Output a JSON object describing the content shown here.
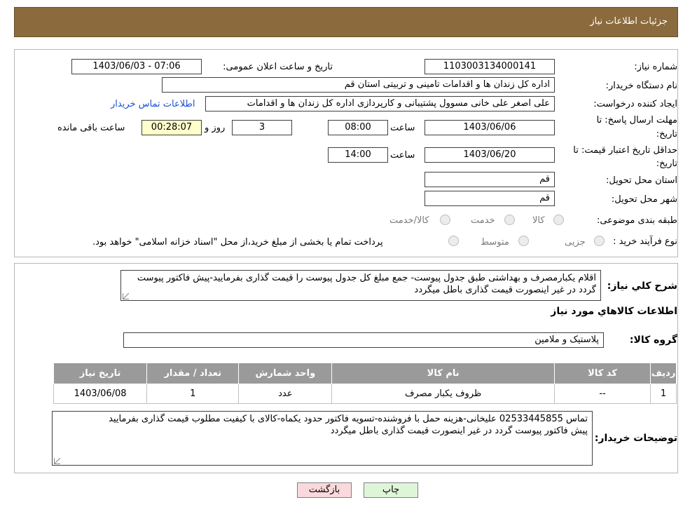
{
  "header": {
    "title": "جزئیات اطلاعات نیاز"
  },
  "form": {
    "need_number_label": "شماره نیاز:",
    "need_number": "1103003134000141",
    "announce_label": "تاریخ و ساعت اعلان عمومی:",
    "announce_value": "1403/06/03 - 07:06",
    "buyer_label": "نام دستگاه خریدار:",
    "buyer_value": "اداره کل زندان ها و اقدامات تامینی و تربیتی استان قم",
    "creator_label": "ایجاد کننده درخواست:",
    "creator_value": "علی اصغر علی خانی مسوول پشتیبانی و کارپردازی اداره کل زندان ها و اقدامات",
    "contact_link": "اطلاعات تماس خریدار",
    "deadline_label_1": "مهلت ارسال پاسخ: تا",
    "deadline_label_2": "تاریخ:",
    "deadline_date": "1403/06/06",
    "time_label": "ساعت",
    "deadline_time": "08:00",
    "days_value": "3",
    "days_label": "روز و",
    "remaining_value": "00:28:07",
    "remaining_label": "ساعت باقی مانده",
    "validity_label_1": "حداقل تاریخ اعتبار قیمت: تا",
    "validity_label_2": "تاریخ:",
    "validity_date": "1403/06/20",
    "validity_time": "14:00",
    "province_label": "استان محل تحویل:",
    "province_value": "قم",
    "city_label": "شهر محل تحویل:",
    "city_value": "قم",
    "category_label": "طبقه بندی موضوعی:",
    "category_options": [
      "کالا",
      "خدمت",
      "کالا/خدمت"
    ],
    "process_label": "نوع فرآیند خرید :",
    "process_options": [
      "جزیی",
      "متوسط"
    ],
    "process_note": "پرداخت تمام یا بخشی از مبلغ خرید،از محل \"اسناد خزانه اسلامی\" خواهد بود."
  },
  "details": {
    "summary_label": "شرح کلي نياز:",
    "summary_value": "اقلام یکبارمصرف و بهداشتی طبق جدول پیوست- جمع مبلغ کل جدول پیوست را قیمت گذاری بفرمایید-پیش فاکتور پیوست گردد در غیر اینصورت قیمت گذاری باطل میگردد",
    "goods_info_title": "اطلاعات کالاهاي مورد نياز",
    "goods_group_label": "گروه کالا:",
    "goods_group_value": "پلاستیک و ملامین",
    "table_headers": [
      "ردیف",
      "کد کالا",
      "نام کالا",
      "واحد شمارش",
      "تعداد / مقدار",
      "تاریخ نیاز"
    ],
    "table_rows": [
      [
        "1",
        "--",
        "ظروف یکبار مصرف",
        "عدد",
        "1",
        "1403/06/08"
      ]
    ],
    "buyer_notes_label": "توضیحات خریدار:",
    "buyer_notes_value_1": "تماس 02533445855 علیخانی-هزینه حمل با فروشنده-تسویه فاکتور حدود یکماه-کالای با کیفیت مطلوب قیمت گذاری بفرمایید",
    "buyer_notes_value_2": "پیش فاکتور پیوست گردد در غیر اینصورت قیمت گذاری باطل میگردد"
  },
  "buttons": {
    "print": "چاپ",
    "back": "بازگشت"
  },
  "colors": {
    "header": "#8b6a3e",
    "table_header": "#9a9a9a",
    "remaining_bg": "#ffffcc",
    "link": "#1a4fd6"
  }
}
